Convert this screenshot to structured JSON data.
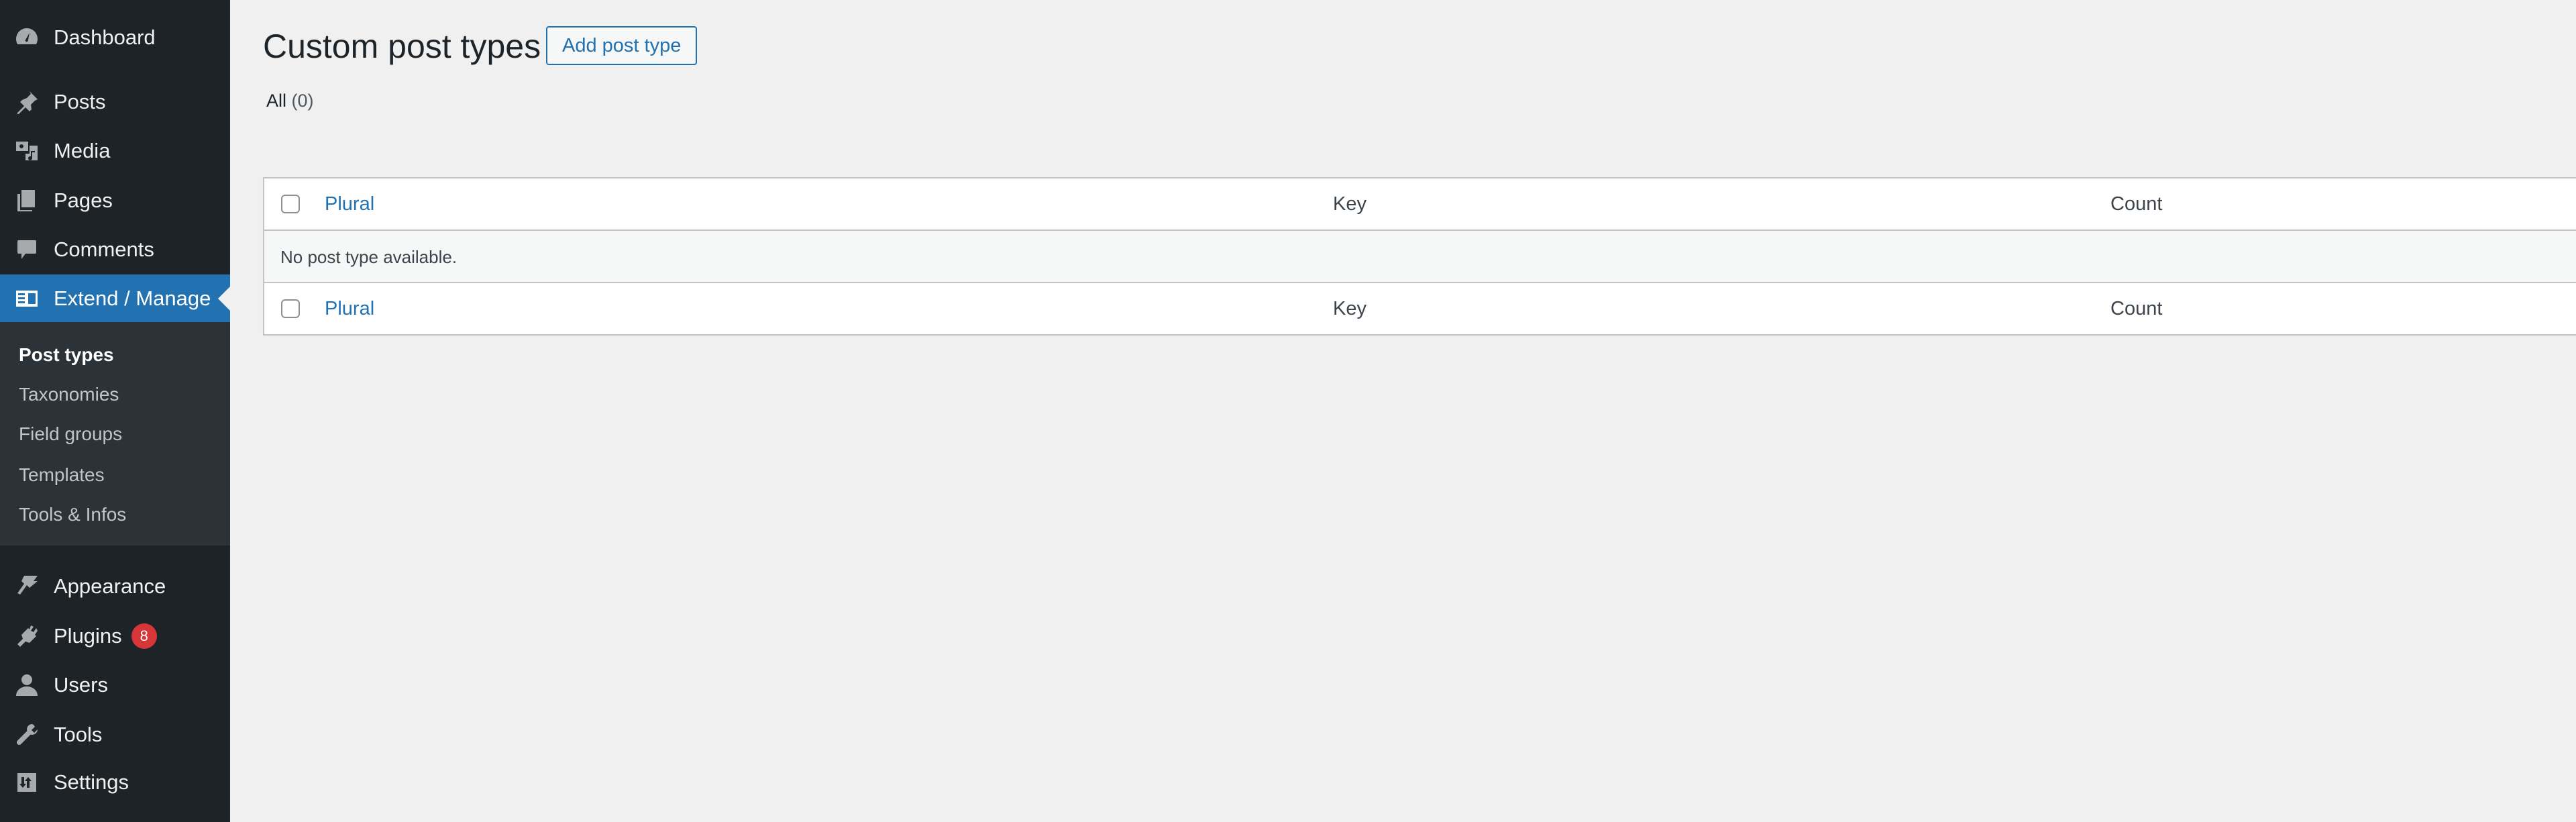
{
  "sidebar": {
    "items": [
      {
        "label": "Dashboard",
        "icon": "dashboard-icon"
      },
      {
        "label": "Posts",
        "icon": "pushpin-icon"
      },
      {
        "label": "Media",
        "icon": "media-icon"
      },
      {
        "label": "Pages",
        "icon": "pages-icon"
      },
      {
        "label": "Comments",
        "icon": "comment-icon"
      },
      {
        "label": "Extend / Manage",
        "icon": "extend-icon",
        "active": true
      },
      {
        "label": "Appearance",
        "icon": "paintbrush-icon"
      },
      {
        "label": "Plugins",
        "icon": "plugin-icon",
        "badge": "8"
      },
      {
        "label": "Users",
        "icon": "user-icon"
      },
      {
        "label": "Tools",
        "icon": "wrench-icon"
      },
      {
        "label": "Settings",
        "icon": "settings-icon"
      }
    ],
    "submenu": [
      {
        "label": "Post types",
        "current": true
      },
      {
        "label": "Taxonomies"
      },
      {
        "label": "Field groups"
      },
      {
        "label": "Templates"
      },
      {
        "label": "Tools & Infos"
      }
    ]
  },
  "main": {
    "title": "Custom post types",
    "add_button": "Add post type",
    "filter": {
      "label": "All",
      "count": "(0)"
    },
    "table": {
      "columns": [
        "Plural",
        "Key",
        "Count"
      ],
      "empty_message": "No post type available."
    }
  },
  "colors": {
    "sidebar_bg": "#1d2327",
    "submenu_bg": "#2c3338",
    "accent": "#2271b1",
    "badge": "#d63638",
    "page_bg": "#f0f0f1"
  }
}
